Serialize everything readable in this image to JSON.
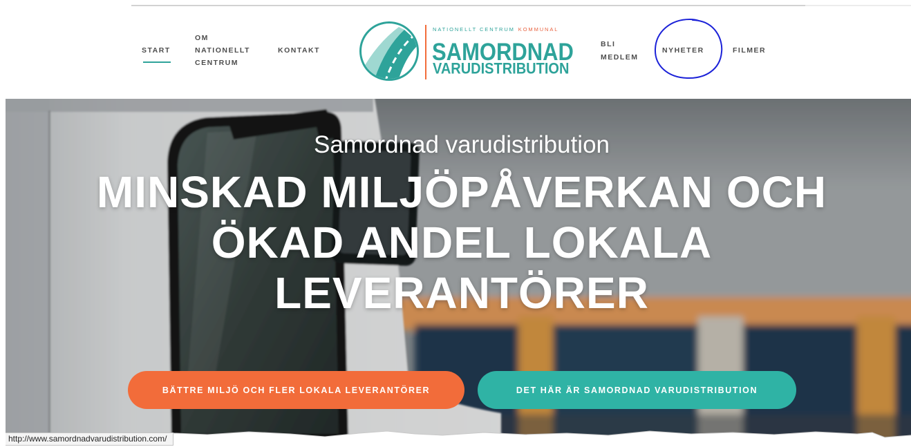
{
  "header": {
    "nav": [
      {
        "lines": [
          "START"
        ],
        "active": true
      },
      {
        "lines": [
          "OM",
          "NATIONELLT",
          "CENTRUM"
        ]
      },
      {
        "lines": [
          "KONTAKT"
        ]
      },
      {
        "lines": [
          "BLI",
          "MEDLEM"
        ]
      },
      {
        "lines": [
          "NYHETER"
        ]
      },
      {
        "lines": [
          "FILMER"
        ]
      }
    ],
    "logo": {
      "icon": "road-circle-icon",
      "tagline": "NATIONELLT CENTRUM",
      "tagline_highlight": "KOMMUNAL",
      "name_line1": "SAMORDNAD",
      "name_line2": "VARUDISTRIBUTION"
    }
  },
  "hero": {
    "subtitle": "Samordnad varudistribution",
    "title_lines": [
      "MINSKAD MILJÖPÅVERKAN OCH",
      "ÖKAD ANDEL LOKALA",
      "LEVERANTÖRER"
    ],
    "buttons": [
      {
        "label": "BÄTTRE MILJÖ OCH FLER LOKALA LEVERANTÖRER",
        "color": "#f26c3a"
      },
      {
        "label": "DET HÄR ÄR SAMORDNAD VARUDISTRIBUTION",
        "color": "#2fb3a5"
      }
    ]
  },
  "status_bar": {
    "url": "http://www.samordnadvarudistribution.com/"
  },
  "colors": {
    "nav_text": "#4d4d4d",
    "teal": "#2ea39a",
    "orange": "#f26c3a",
    "kommunal_red": "#e8623f",
    "annotation_blue": "#1c22d8"
  }
}
